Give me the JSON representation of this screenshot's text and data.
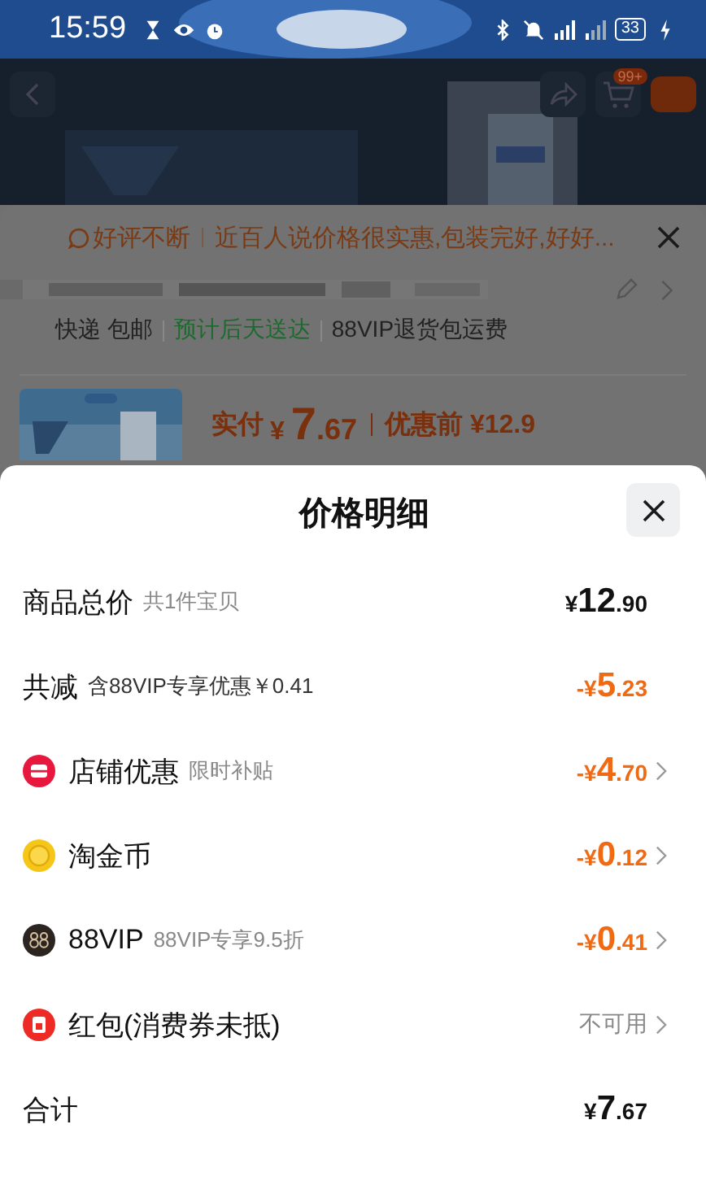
{
  "status_bar": {
    "time": "15:59",
    "battery": "33"
  },
  "nav": {
    "cart_badge": "99+"
  },
  "background_card": {
    "review_tag": "好评不断",
    "review_text": "近百人说价格很实惠,包装完好,好好...",
    "shipping": [
      {
        "text": "快递 包邮",
        "kind": "plain"
      },
      {
        "text": "预计后天送达",
        "kind": "highlight"
      },
      {
        "text": "88VIP退货包运费",
        "kind": "plain"
      }
    ],
    "price": {
      "label": "实付",
      "sign": "¥",
      "whole": "7",
      "fraction": ".67",
      "original": "优惠前 ¥12.9"
    }
  },
  "sheet": {
    "title": "价格明细",
    "rows": [
      {
        "kind": "total",
        "label": "商品总价",
        "note": "共1件宝贝",
        "sign": "¥",
        "whole": "12",
        "fraction": ".90"
      },
      {
        "kind": "reduction",
        "label": "共减",
        "note": "含88VIP专享优惠￥0.41",
        "sign": "-¥",
        "whole": "5",
        "fraction": ".23"
      },
      {
        "kind": "shop",
        "label": "店铺优惠",
        "note": "限时补贴",
        "sign": "-¥",
        "whole": "4",
        "fraction": ".70"
      },
      {
        "kind": "coin",
        "label": "淘金币",
        "sign": "-¥",
        "whole": "0",
        "fraction": ".12"
      },
      {
        "kind": "vip",
        "label": "88VIP",
        "note": "88VIP专享9.5折",
        "sign": "-¥",
        "whole": "0",
        "fraction": ".41"
      },
      {
        "kind": "packet",
        "label": "红包(消费券未抵)",
        "value_text": "不可用"
      },
      {
        "kind": "sum",
        "label": "合计",
        "sign": "¥",
        "whole": "7",
        "fraction": ".67"
      }
    ]
  }
}
